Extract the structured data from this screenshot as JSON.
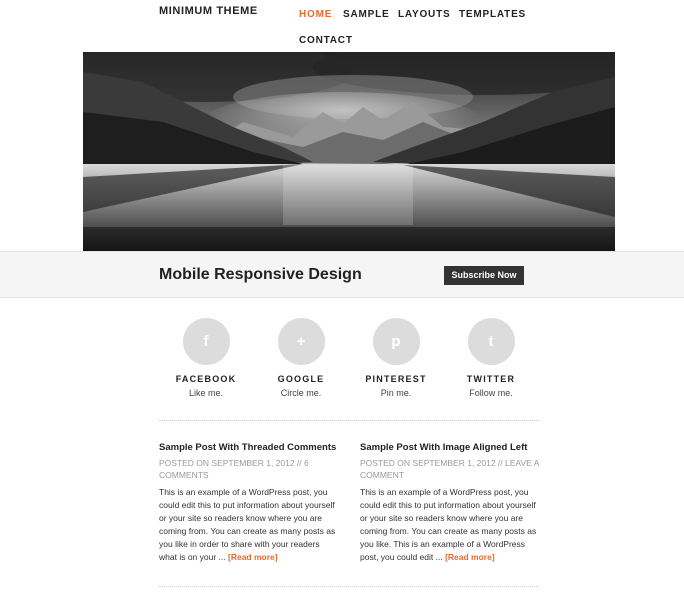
{
  "header": {
    "site_title": "MINIMUM THEME",
    "nav": [
      "HOME",
      "SAMPLE",
      "LAYOUTS",
      "TEMPLATES",
      "CONTACT"
    ],
    "active_nav": "HOME"
  },
  "hero": {
    "image": "black-and-white mountain lake landscape"
  },
  "band": {
    "title": "Mobile Responsive Design",
    "subscribe_label": "Subscribe Now"
  },
  "social": [
    {
      "name": "FACEBOOK",
      "tagline": "Like me.",
      "icon": "facebook-icon",
      "glyph": "f"
    },
    {
      "name": "GOOGLE",
      "tagline": "Circle me.",
      "icon": "plus-icon",
      "glyph": "+"
    },
    {
      "name": "PINTEREST",
      "tagline": "Pin me.",
      "icon": "pinterest-icon",
      "glyph": "p"
    },
    {
      "name": "TWITTER",
      "tagline": "Follow me.",
      "icon": "twitter-icon",
      "glyph": "t"
    }
  ],
  "posts": [
    {
      "title": "Sample Post With Threaded Comments",
      "meta": "POSTED ON SEPTEMBER 1, 2012 // 6 COMMENTS",
      "excerpt": "This is an example of a WordPress post, you could edit this to put information about yourself or your site so readers know where you are coming from. You can create as many posts as you like in order to share with your readers what is on your ...",
      "read_more": "[Read more]"
    },
    {
      "title": "Sample Post With Image Aligned Left",
      "meta": "POSTED ON SEPTEMBER 1, 2012 // LEAVE A COMMENT",
      "excerpt": "This is an example of a WordPress post, you could edit this to put information about yourself or your site so readers know where you are coming from. You can create as many posts as you like. This is an example of a WordPress post, you could edit ...",
      "read_more": "[Read more]"
    }
  ],
  "colors": {
    "accent": "#e66b2f",
    "dark": "#333333",
    "band_bg": "#f5f5f5",
    "social_circle": "#dcdcdc"
  }
}
